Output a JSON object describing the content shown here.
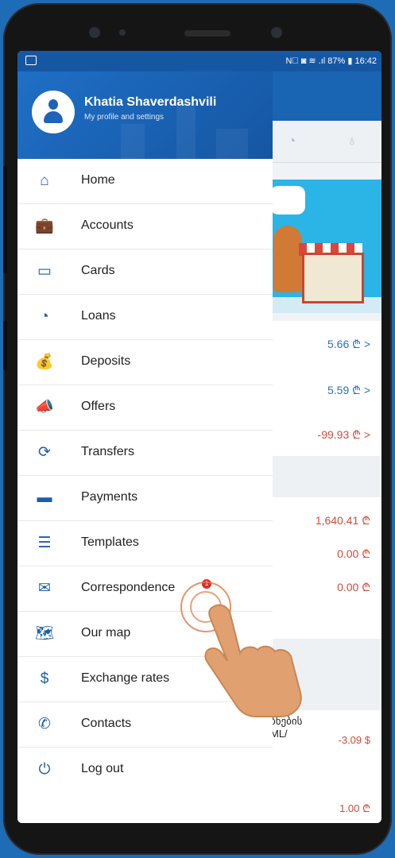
{
  "statusbar": {
    "right_text": "N⃒ ◙ ≋ .ıl 87% ▮ 16:42"
  },
  "profile": {
    "name": "Khatia Shaverdashvili",
    "subtitle": "My profile and settings"
  },
  "menu": [
    {
      "label": "Home",
      "icon": "home-icon",
      "glyph": "⌂"
    },
    {
      "label": "Accounts",
      "icon": "briefcase-icon",
      "glyph": "💼"
    },
    {
      "label": "Cards",
      "icon": "cards-icon",
      "glyph": "▭"
    },
    {
      "label": "Loans",
      "icon": "loans-icon",
      "glyph": "◔"
    },
    {
      "label": "Deposits",
      "icon": "money-bag-icon",
      "glyph": "💰"
    },
    {
      "label": "Offers",
      "icon": "megaphone-icon",
      "glyph": "📣"
    },
    {
      "label": "Transfers",
      "icon": "transfer-icon",
      "glyph": "⟳"
    },
    {
      "label": "Payments",
      "icon": "wallet-icon",
      "glyph": "▬"
    },
    {
      "label": "Templates",
      "icon": "list-icon",
      "glyph": "☰"
    },
    {
      "label": "Correspondence",
      "icon": "envelope-icon",
      "glyph": "✉",
      "badge": "1"
    },
    {
      "label": "Our map",
      "icon": "map-icon",
      "glyph": "🗺"
    },
    {
      "label": "Exchange rates",
      "icon": "exchange-icon",
      "glyph": "$"
    },
    {
      "label": "Contacts",
      "icon": "phone-icon",
      "glyph": "✆"
    },
    {
      "label": "Log out",
      "icon": "power-icon",
      "glyph": "⏻"
    }
  ],
  "background": {
    "amounts_card": [
      "5.66 ₾ >",
      "5.59 ₾ >",
      "-99.93 ₾ >"
    ],
    "amounts_list": [
      "1,640.41 ₾",
      "0.00 ₾",
      "0.00 ₾"
    ],
    "georgian_line1": "ბნების",
    "georgian_line2": "ML/",
    "amount_usd": "-3.09 $",
    "amount_bottom": "1.00 ₾"
  },
  "colors": {
    "brand_blue": "#1a64b4",
    "accent_red": "#d24a3a",
    "hand": "#e0a070"
  }
}
